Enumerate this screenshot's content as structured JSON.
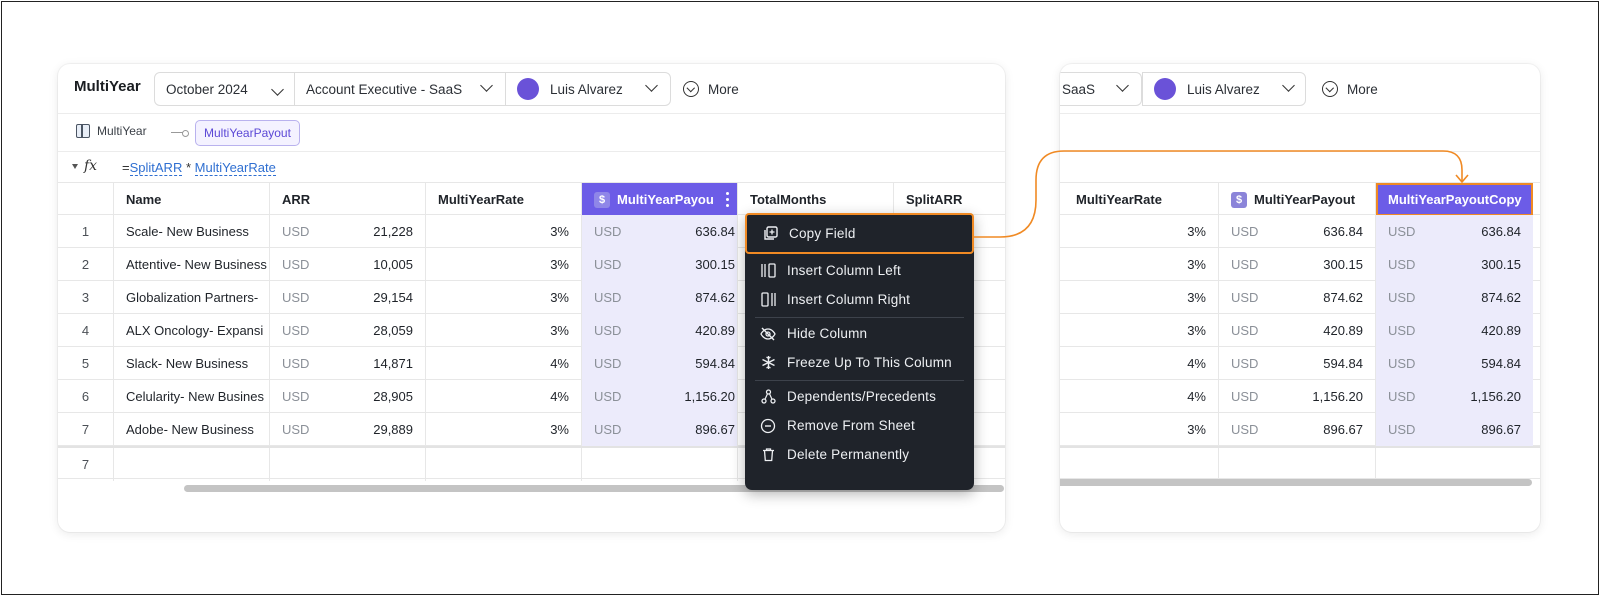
{
  "left_panel": {
    "title": "MultiYear",
    "period": "October 2024",
    "role": "Account Executive - SaaS",
    "user": "Luis Alvarez",
    "more": "More",
    "breadcrumb": {
      "sheet": "MultiYear",
      "chip": "MultiYearPayout"
    },
    "formula": {
      "eq": "=",
      "ref1": "SplitARR",
      "op": " * ",
      "ref2": "MultiYearRate"
    },
    "columns": [
      "Name",
      "ARR",
      "MultiYearRate",
      "MultiYearPayou",
      "TotalMonths",
      "SplitARR"
    ],
    "rows": [
      {
        "idx": "1",
        "name": "Scale- New Business",
        "arr_cur": "USD",
        "arr": "21,228",
        "rate": "3%",
        "pay_cur": "USD",
        "pay": "636.84"
      },
      {
        "idx": "2",
        "name": "Attentive- New Business",
        "arr_cur": "USD",
        "arr": "10,005",
        "rate": "3%",
        "pay_cur": "USD",
        "pay": "300.15"
      },
      {
        "idx": "3",
        "name": "Globalization Partners-",
        "arr_cur": "USD",
        "arr": "29,154",
        "rate": "3%",
        "pay_cur": "USD",
        "pay": "874.62"
      },
      {
        "idx": "4",
        "name": "ALX Oncology- Expansi",
        "arr_cur": "USD",
        "arr": "28,059",
        "rate": "3%",
        "pay_cur": "USD",
        "pay": "420.89"
      },
      {
        "idx": "5",
        "name": "Slack- New Business",
        "arr_cur": "USD",
        "arr": "14,871",
        "rate": "4%",
        "pay_cur": "USD",
        "pay": "594.84"
      },
      {
        "idx": "6",
        "name": "Celularity- New Busines",
        "arr_cur": "USD",
        "arr": "28,905",
        "rate": "4%",
        "pay_cur": "USD",
        "pay": "1,156.20"
      },
      {
        "idx": "7",
        "name": "Adobe- New Business",
        "arr_cur": "USD",
        "arr": "29,889",
        "rate": "3%",
        "pay_cur": "USD",
        "pay": "896.67"
      }
    ],
    "footer_idx": "7"
  },
  "context_menu": {
    "items": [
      {
        "label": "Copy Field",
        "icon": "copy-icon"
      },
      {
        "label": "Insert Column Left",
        "icon": "insert-column-left-icon"
      },
      {
        "label": "Insert Column Right",
        "icon": "insert-column-right-icon"
      },
      {
        "label": "Hide Column",
        "icon": "eye-off-icon"
      },
      {
        "label": "Freeze Up To This Column",
        "icon": "snowflake-icon"
      },
      {
        "label": "Dependents/Precedents",
        "icon": "graph-icon"
      },
      {
        "label": "Remove From Sheet",
        "icon": "minus-circle-icon"
      },
      {
        "label": "Delete Permanently",
        "icon": "trash-icon"
      }
    ]
  },
  "right_panel": {
    "role_partial": "SaaS",
    "user": "Luis Alvarez",
    "more": "More",
    "columns": [
      "MultiYearRate",
      "MultiYearPayout",
      "MultiYearPayoutCopy"
    ],
    "rows": [
      {
        "rate": "3%",
        "pay_cur": "USD",
        "pay": "636.84",
        "copy_cur": "USD",
        "copy": "636.84"
      },
      {
        "rate": "3%",
        "pay_cur": "USD",
        "pay": "300.15",
        "copy_cur": "USD",
        "copy": "300.15"
      },
      {
        "rate": "3%",
        "pay_cur": "USD",
        "pay": "874.62",
        "copy_cur": "USD",
        "copy": "874.62"
      },
      {
        "rate": "3%",
        "pay_cur": "USD",
        "pay": "420.89",
        "copy_cur": "USD",
        "copy": "420.89"
      },
      {
        "rate": "4%",
        "pay_cur": "USD",
        "pay": "594.84",
        "copy_cur": "USD",
        "copy": "594.84"
      },
      {
        "rate": "4%",
        "pay_cur": "USD",
        "pay": "1,156.20",
        "copy_cur": "USD",
        "copy": "1,156.20"
      },
      {
        "rate": "3%",
        "pay_cur": "USD",
        "pay": "896.67",
        "copy_cur": "USD",
        "copy": "896.67"
      }
    ]
  },
  "colors": {
    "accent": "#6c5ce7",
    "highlight": "#f08a24",
    "menu_bg": "#1f232a"
  }
}
